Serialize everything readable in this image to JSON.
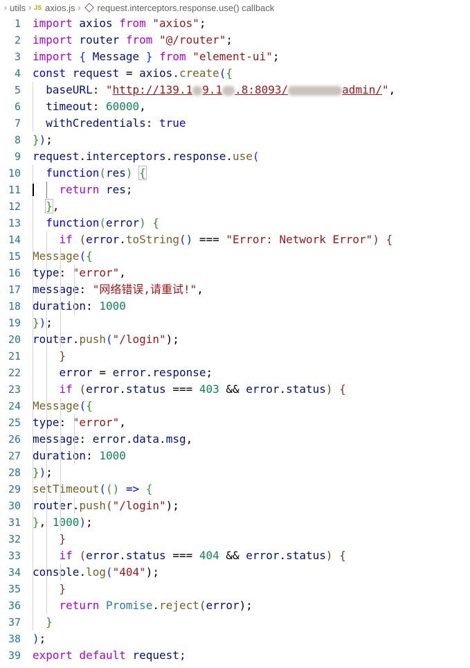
{
  "breadcrumb": {
    "folder": "utils",
    "file_badge": "JS",
    "file": "axios.js",
    "symbol": "request.interceptors.response.use() callback"
  },
  "line_numbers": [
    "1",
    "2",
    "3",
    "4",
    "5",
    "6",
    "7",
    "8",
    "9",
    "10",
    "11",
    "12",
    "13",
    "14",
    "15",
    "16",
    "17",
    "18",
    "19",
    "20",
    "21",
    "22",
    "23",
    "24",
    "25",
    "26",
    "27",
    "28",
    "29",
    "30",
    "31",
    "32",
    "33",
    "34",
    "35",
    "36",
    "37",
    "38",
    "39"
  ],
  "code": {
    "l1": [
      "import",
      " axios ",
      "from",
      " ",
      "\"axios\"",
      ";"
    ],
    "l2": [
      "import",
      " router ",
      "from",
      " ",
      "\"@/router\"",
      ";"
    ],
    "l3": [
      "import",
      " ",
      "{",
      " Message ",
      "}",
      " ",
      "from",
      " ",
      "\"element-ui\"",
      ";"
    ],
    "l4": [
      "const",
      " request ",
      "=",
      " axios.",
      "create",
      "(",
      "{"
    ],
    "l5": [
      "baseURL",
      ": ",
      "\"",
      "http://139.1",
      "9.1",
      ".8:8093/",
      "admin/",
      "\"",
      ","
    ],
    "l6": [
      "timeout",
      ": ",
      "60000",
      ","
    ],
    "l7": [
      "withCredentials",
      ": ",
      "true"
    ],
    "l8": [
      "}",
      ")",
      ";"
    ],
    "l9": [
      "request",
      ".",
      "interceptors",
      ".",
      "response",
      ".",
      "use",
      "("
    ],
    "l10": [
      "function",
      "(",
      "res",
      ")",
      " ",
      "{"
    ],
    "l11": [
      "return",
      " res;"
    ],
    "l12": [
      "}",
      ","
    ],
    "l13": [
      "function",
      "(",
      "error",
      ")",
      " ",
      "{"
    ],
    "l14": [
      "if",
      " ",
      "(",
      "error",
      ".",
      "toString",
      "()",
      " === ",
      "\"Error: Network Error\"",
      ")",
      " ",
      "{"
    ],
    "l15": [
      "Message",
      "(",
      "{"
    ],
    "l16": [
      "type",
      ": ",
      "\"error\"",
      ","
    ],
    "l17": [
      "message",
      ": ",
      "\"网络错误,请重试!\"",
      ","
    ],
    "l18": [
      "duration",
      ": ",
      "1000"
    ],
    "l19": [
      "}",
      ")",
      ";"
    ],
    "l20": [
      "router",
      ".",
      "push",
      "(",
      "\"/login\"",
      ");"
    ],
    "l21": [
      "}"
    ],
    "l22": [
      "error",
      " = ",
      "error",
      ".",
      "response",
      ";"
    ],
    "l23": [
      "if",
      " ",
      "(",
      "error",
      ".",
      "status",
      " === ",
      "403",
      " && ",
      "error",
      ".",
      "status",
      ")",
      " ",
      "{"
    ],
    "l24": [
      "Message",
      "(",
      "{"
    ],
    "l25": [
      "type",
      ": ",
      "\"error\"",
      ","
    ],
    "l26": [
      "message",
      ": ",
      "error",
      ".",
      "data",
      ".",
      "msg",
      ","
    ],
    "l27": [
      "duration",
      ": ",
      "1000"
    ],
    "l28": [
      "}",
      ")",
      ";"
    ],
    "l29": [
      "setTimeout",
      "(",
      "()",
      " => ",
      "{"
    ],
    "l30": [
      "router",
      ".",
      "push",
      "(",
      "\"/login\"",
      ");"
    ],
    "l31": [
      "}",
      ", ",
      "1000",
      ")",
      ";"
    ],
    "l32": [
      "}"
    ],
    "l33": [
      "if",
      " ",
      "(",
      "error",
      ".",
      "status",
      " === ",
      "404",
      " && ",
      "error",
      ".",
      "status",
      ")",
      " ",
      "{"
    ],
    "l34": [
      "console",
      ".",
      "log",
      "(",
      "\"404\"",
      ");"
    ],
    "l35": [
      "}"
    ],
    "l36": [
      "return",
      " ",
      "Promise",
      ".",
      "reject",
      "(",
      "error",
      ");"
    ],
    "l37": [
      "}"
    ],
    "l38": [
      ")",
      ";"
    ],
    "l39": [
      "export",
      " ",
      "default",
      " request;"
    ]
  },
  "colors": {
    "keyword": "#0000ff",
    "control": "#af00db",
    "string": "#a31515",
    "number": "#098658",
    "function": "#795e26",
    "variable": "#001080",
    "line_number": "#237893"
  }
}
